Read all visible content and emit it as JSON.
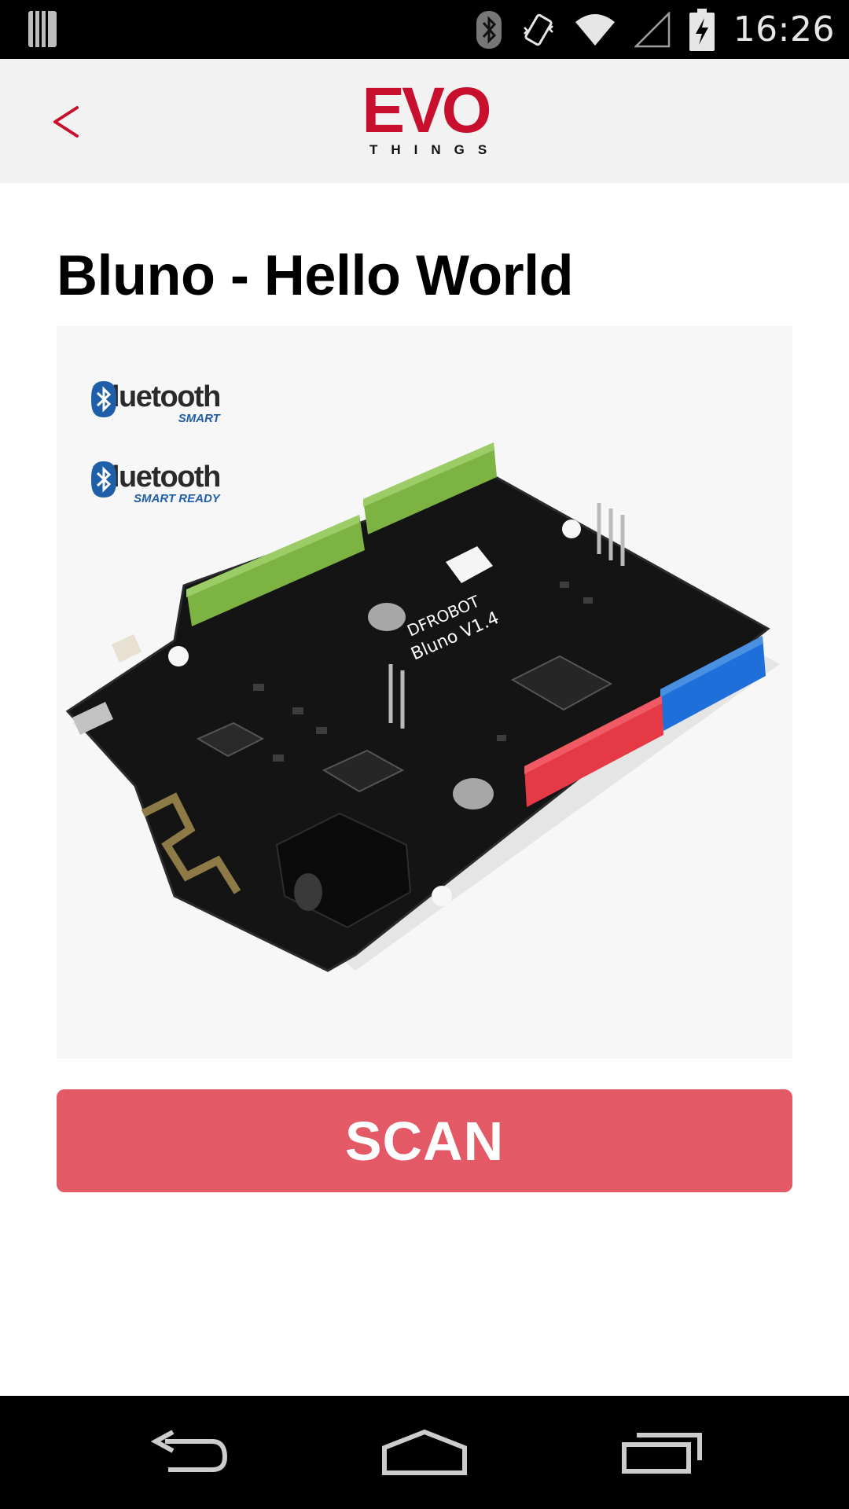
{
  "status_bar": {
    "time": "16:26",
    "icons": [
      "notification-icon",
      "bluetooth-icon",
      "vibrate-icon",
      "wifi-icon",
      "signal-icon",
      "battery-charging-icon"
    ]
  },
  "header": {
    "back_icon": "chevron-left-icon",
    "logo_main": "EVO",
    "logo_sub": "THINGS",
    "accent_color": "#c8102e"
  },
  "page": {
    "title": "Bluno - Hello World"
  },
  "image": {
    "badges": [
      {
        "name": "Bluetooth",
        "sub": "SMART"
      },
      {
        "name": "Bluetooth",
        "sub": "SMART READY"
      }
    ],
    "board_brand": "DFROBOT",
    "board_model": "Bluno V1.4"
  },
  "actions": {
    "scan_label": "SCAN",
    "scan_color": "#e35a66"
  },
  "nav_bar": {
    "icons": [
      "back-nav-icon",
      "home-nav-icon",
      "recents-nav-icon"
    ]
  }
}
